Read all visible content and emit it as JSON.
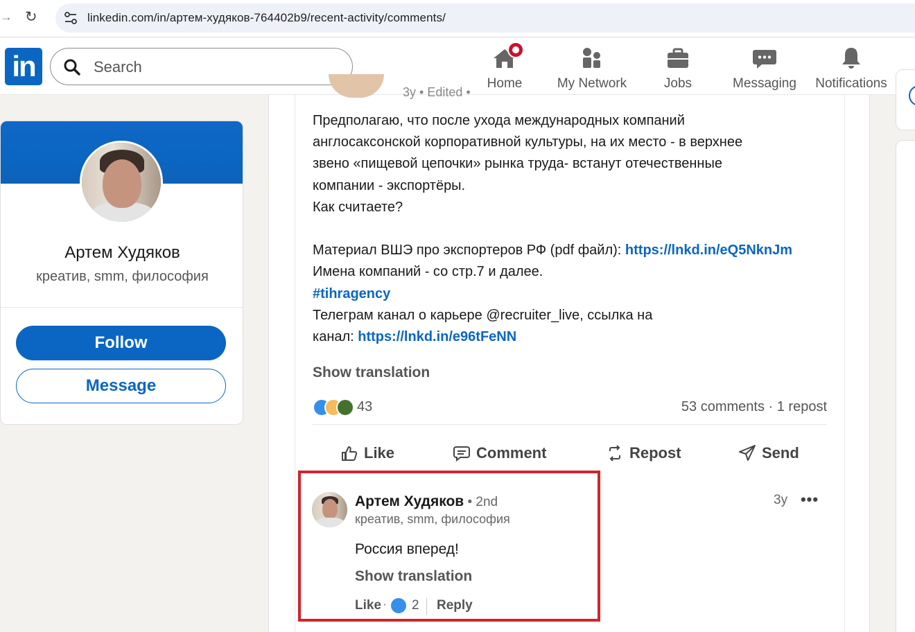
{
  "browser": {
    "url": "linkedin.com/in/артем-худяков-764402b9/recent-activity/comments/"
  },
  "header": {
    "logo_text": "in",
    "search_placeholder": "Search",
    "nav": {
      "home": "Home",
      "my_network": "My Network",
      "jobs": "Jobs",
      "messaging": "Messaging",
      "notifications": "Notifications"
    }
  },
  "profile": {
    "name": "Артем Худяков",
    "headline": "креатив, smm, философия",
    "follow_label": "Follow",
    "message_label": "Message"
  },
  "post": {
    "meta_partial": "3y • Edited •",
    "lines": [
      "Предполагаю, что после ухода международных компаний",
      "англосаксонской корпоративной культуры, на их место - в верхнее",
      "звено «пищевой цепочки» рынка труда- встанут отечественные",
      "компании - экспортёры.",
      "Как считаете?",
      "",
      "Материал ВШЭ про экспортеров РФ (pdf файл): ",
      " Имена компаний - со стр.7 и далее.",
      "#tihragency",
      "Телеграм канал о карьере @recruiter_live, ссылка на",
      "канал: "
    ],
    "link_1": "https://lnkd.in/eQ5NknJm",
    "link_2": "https://lnkd.in/e96tFeNN",
    "show_translation": "Show translation",
    "reaction_count": "43",
    "comments_info": "53 comments · 1 repost",
    "actions": {
      "like": "Like",
      "comment": "Comment",
      "repost": "Repost",
      "send": "Send"
    }
  },
  "comment": {
    "author": "Артем Худяков",
    "degree": " • 2nd",
    "headline": "креатив, smm, философия",
    "time": "3y",
    "more": "•••",
    "text": "Россия вперед!",
    "show_translation": "Show translation",
    "like_label": "Like",
    "dot": "·",
    "like_count": "2",
    "reply_label": "Reply"
  },
  "colors": {
    "linkedin_blue": "#0a66c2",
    "highlight_red": "#d2232a",
    "notification_red": "#cb112d"
  }
}
